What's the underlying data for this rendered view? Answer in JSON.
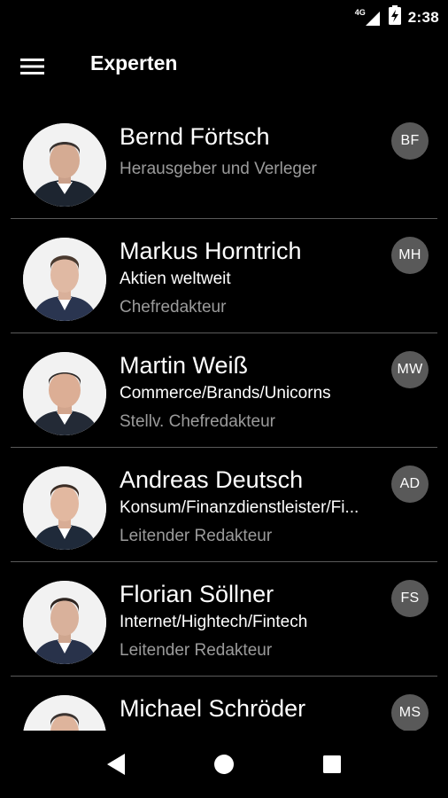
{
  "status": {
    "network": "4G",
    "time": "2:38"
  },
  "appbar": {
    "title": "Experten"
  },
  "experts": [
    {
      "name": "Bernd Förtsch",
      "subtitle": "",
      "role": "Herausgeber und Verleger",
      "initials": "BF"
    },
    {
      "name": "Markus Horntrich",
      "subtitle": "Aktien weltweit",
      "role": "Chefredakteur",
      "initials": "MH"
    },
    {
      "name": "Martin Weiß",
      "subtitle": "Commerce/Brands/Unicorns",
      "role": "Stellv. Chefredakteur",
      "initials": "MW"
    },
    {
      "name": "Andreas Deutsch",
      "subtitle": "Konsum/Finanzdienstleister/Fi...",
      "role": "Leitender Redakteur",
      "initials": "AD"
    },
    {
      "name": "Florian Söllner",
      "subtitle": "Internet/Hightech/Fintech",
      "role": "Leitender Redakteur",
      "initials": "FS"
    },
    {
      "name": "Michael Schröder",
      "subtitle": "",
      "role": "",
      "initials": "MS"
    }
  ],
  "colors": {
    "background": "#000000",
    "badge": "#595959",
    "muted_text": "#9b9b9b",
    "divider": "#5a5a5a"
  },
  "icons": {
    "menu": "hamburger-menu-icon",
    "back": "back-triangle-icon",
    "home": "home-circle-icon",
    "recents": "recents-square-icon"
  }
}
